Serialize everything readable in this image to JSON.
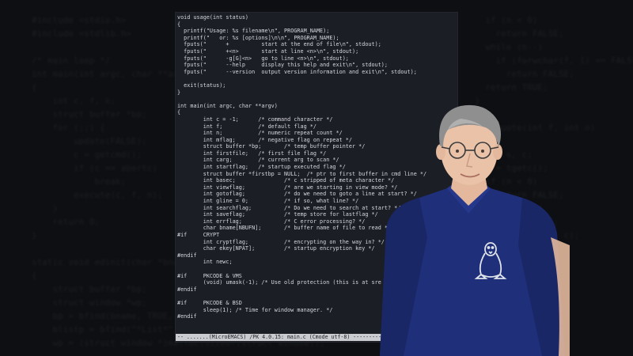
{
  "editor": {
    "lines": [
      "void usage(int status)",
      "{",
      "  printf(\"Usage: %s filename\\n\", PROGRAM_NAME);",
      "  printf(\"   or: %s [options]\\n\\n\", PROGRAM_NAME);",
      "  fputs(\"      +          start at the end of file\\n\", stdout);",
      "  fputs(\"      +<n>       start at line <n>\\n\", stdout);",
      "  fputs(\"      -g[G]<n>   go to line <n>\\n\", stdout);",
      "  fputs(\"      --help     display this help and exit\\n\", stdout);",
      "  fputs(\"      --version  output version information and exit\\n\", stdout);",
      "",
      "  exit(status);",
      "}",
      "",
      "int main(int argc, char **argv)",
      "{",
      "        int c = -1;      /* command character */",
      "        int f;           /* default flag */",
      "        int n;           /* numeric repeat count */",
      "        int mflag;       /* negative flag on repeat */",
      "        struct buffer *bp;       /* temp buffer pointer */",
      "        int firstfile;   /* first file flag */",
      "        int carg;        /* current arg to scan */",
      "        int startflag;   /* startup executed flag */",
      "        struct buffer *firstbp = NULL;  /* ptr to first buffer in cmd line */",
      "        int basec;               /* c stripped of meta character */",
      "        int viewflag;            /* are we starting in view mode? */",
      "        int gotoflag;            /* do we need to goto a line at start? */",
      "        int gline = 0;           /* if so, what line? */",
      "        int searchflag;          /* Do we need to search at start? */",
      "        int saveflag;            /* temp store for lastflag */",
      "        int errflag;             /* C error processing? */",
      "        char bname[NBUFN];       /* buffer name of file to read */",
      "#if     CRYPT",
      "        int cryptflag;           /* encrypting on the way in? */",
      "        char ekey[NPAT];         /* startup encryption key */",
      "#endif",
      "        int newc;",
      "",
      "#if     PKCODE & VMS",
      "        (void) umask(-1); /* Use old protection (this is at sre",
      "#endif",
      "",
      "#if     PKCODE & BSD",
      "        sleep(1); /* Time for window manager. */",
      "#endif"
    ],
    "modeline": "-- .......(MicroEMACS) /PK 4.0.15: main.c (Cmode utf-8) ---------------------------------"
  },
  "background_code": {
    "left": "#include <stdio.h>\n#include <stdlib.h>\n\n/* main loop */\nint main(int argc, char **argv)\n{\n    int c, f, n;\n    struct buffer *bp;\n    for (;;) {\n        update(FALSE);\n        c = getcmd();\n        if (c == abortc)\n            break;\n        execute(c, f, n);\n    }\n    return 0;\n}\n\nstatic void edinit(char *bname)\n{\n    struct buffer *bp;\n    struct window *wp;\n    bp = bfind(bname, TRUE, 0);\n    blistp = bfind(\"*List*\", TRUE, BFINVS);\n    wp = (struct window *)malloc(sizeof(struct window));\n}\n",
    "right": "  if (n < 0)\n    return FALSE;\n  while (n--)\n    if (forwchar(f, 1) == FALSE)\n      return FALSE;\n  return TRUE;\n}\n\nint quote(int f, int n)\n{\n  int s, c;\n  c = tgetc();\n  if (n < 0)\n    return FALSE;\n  if (n == 0)\n    return TRUE;\n  s = linsert(n, c);\n  return s;\n}\n"
  },
  "colors": {
    "page_bg": "#0e0f12",
    "editor_bg": "#1b1e25",
    "code_text": "#d6d8dd",
    "modeline_bg": "#c9cbd0",
    "shirt": "#1f2f7a",
    "skin": "#e9c2a8",
    "hair": "#8f8f8f"
  },
  "illustration": {
    "subject": "man-in-blue-polo-with-penguin-logo",
    "logo": "tux-penguin-icon"
  }
}
